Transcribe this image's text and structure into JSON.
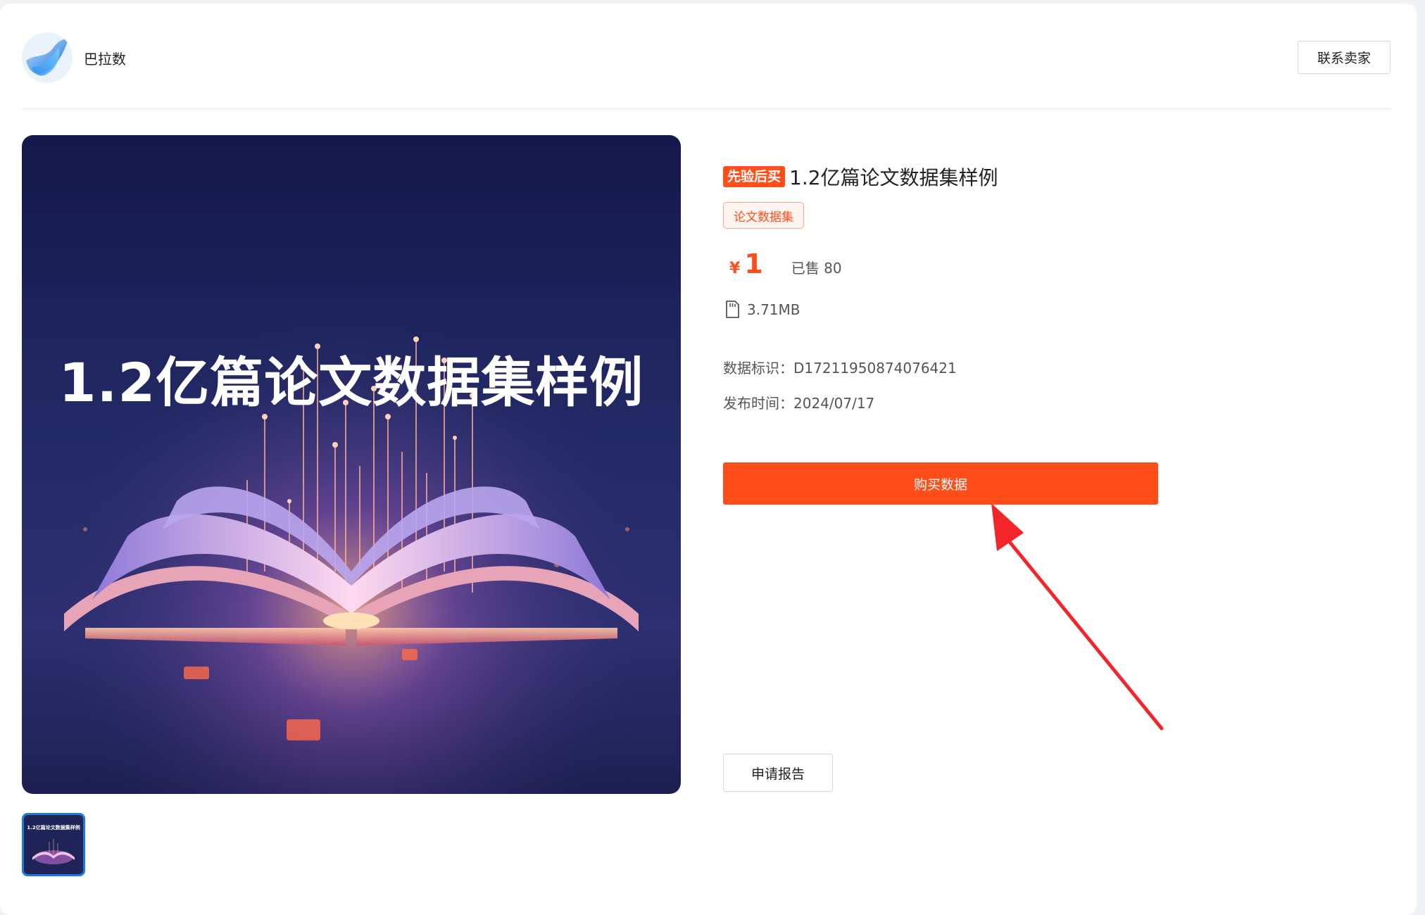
{
  "seller": {
    "name": "巴拉数",
    "contact_label": "联系卖家"
  },
  "product": {
    "promo_badge": "先验后买",
    "title": "1.2亿篇论文数据集样例",
    "category": "论文数据集",
    "currency": "¥",
    "price": "1",
    "sold": "已售 80",
    "file_size": "3.71MB",
    "data_id": "数据标识：D17211950874076421",
    "publish_date": "发布时间：2024/07/17",
    "cover_text": "1.2亿篇论文数据集样例"
  },
  "actions": {
    "buy_label": "购买数据",
    "report_label": "申请报告"
  },
  "icons": {
    "file": "sd-card-icon",
    "avatar": "bird-logo-icon"
  },
  "colors": {
    "accent": "#ff4e1a",
    "thumb_border": "#1f7ae0",
    "cover_bg": "#1a1d4e"
  }
}
